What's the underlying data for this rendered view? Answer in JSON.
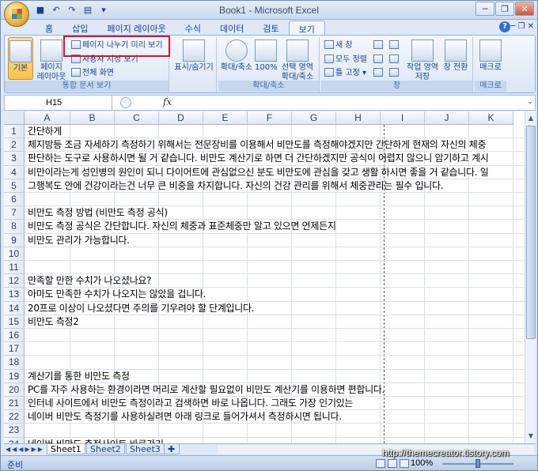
{
  "window": {
    "title": "Book1 - Microsoft Excel"
  },
  "ribbon": {
    "tabs": [
      "홈",
      "삽입",
      "페이지 레이아웃",
      "수식",
      "데이터",
      "검토",
      "보기"
    ],
    "active_tab": "보기",
    "groups": {
      "workbook_views": {
        "label": "통합 문서 보기",
        "normal": "기본",
        "page_layout": "페이지 레이아웃",
        "page_break_preview": "페이지 나누기 미리 보기",
        "custom_views": "사용자 지정 보기",
        "full_screen": "전체 화면"
      },
      "show_hide": {
        "label": "표시/숨기기"
      },
      "zoom": {
        "label": "확대/축소",
        "zoom": "확대/축소",
        "pct100": "100%",
        "zoom_selection": "선택 영역 확대/축소"
      },
      "window": {
        "label": "창",
        "new_window": "새 창",
        "arrange_all": "모두 정렬",
        "freeze": "틀 고정",
        "save_workspace": "작업 영역 저장",
        "switch_windows": "창 전환"
      },
      "macros": {
        "label": "매크로",
        "macros": "매크로"
      }
    }
  },
  "formula_bar": {
    "name_box": "H15",
    "fx": "fx"
  },
  "sheet": {
    "columns": [
      "A",
      "B",
      "C",
      "D",
      "E",
      "F",
      "G",
      "H",
      "I",
      "J",
      "K"
    ],
    "rows": [
      {
        "n": "1",
        "text": "간단하게"
      },
      {
        "n": "2",
        "text": "체지방등 조금 자세하기 측정하기 위해서는 전문장비를 이용해서 비만도를 측정해야겠지만 간단하게 현재의 자신의 체중"
      },
      {
        "n": "3",
        "text": "판단하는 도구로 사용하시면 될 거 같습니다. 비만도 계산기로 하면 더 간단하겠지만 공식이 어렵지 않으니 암기하고 계시"
      },
      {
        "n": "4",
        "text": "비만이라는게 성인병의 원인이 되니 다이어트에 관심없으신 분도 비만도에 관심을 갖고 생활 하시면 좋을 거 같습니다. 일"
      },
      {
        "n": "5",
        "text": "그행복도 안에 건강이라는건 너무 큰 비중을 차지합니다. 자신의 건강 관리를 위해서 체중관리는 필수 입니다."
      },
      {
        "n": "6",
        "text": ""
      },
      {
        "n": "7",
        "text": " 비만도 측정 방법 (비만도 측정 공식)"
      },
      {
        "n": "8",
        "text": "비만도 측정 공식은 간단합니다. 자신의 체중과 표준체중만 알고 있으면 언제든지"
      },
      {
        "n": "9",
        "text": "비만도 관리가 가능합니다."
      },
      {
        "n": "10",
        "text": ""
      },
      {
        "n": "11",
        "text": ""
      },
      {
        "n": "12",
        "text": "만족할 만한 수치가 나오셨나요?"
      },
      {
        "n": "13",
        "text": "아마도 만족한 수치가 나오지는 않았을 겁니다."
      },
      {
        "n": "14",
        "text": "20프로 이상이 나오셨다면 주의를 기우려야 할 단계입니다."
      },
      {
        "n": "15",
        "text": "비만도 측정2"
      },
      {
        "n": "16",
        "text": ""
      },
      {
        "n": "17",
        "text": ""
      },
      {
        "n": "18",
        "text": ""
      },
      {
        "n": "19",
        "text": " 계산기를 통한 비만도 측정"
      },
      {
        "n": "20",
        "text": "PC를 자주 사용하는 환경이라면 머리로 계산할 필요없이 비만도 계산기를 이용하면 편합니다."
      },
      {
        "n": "21",
        "text": "인터네 사이트에서 비만도 측정이라고 검색하면 바로 나옵니다. 그래도 가장 인기있는"
      },
      {
        "n": "22",
        "text": "네이버 비만도 측정기를 사용하실려면 아래 링크로 들어가셔서 측정하시면 됩니다."
      },
      {
        "n": "23",
        "text": ""
      },
      {
        "n": "24",
        "text": "네이버 비만도 측정사이트 바로가기"
      }
    ],
    "tabs": [
      "Sheet1",
      "Sheet2",
      "Sheet3"
    ],
    "active_tab": "Sheet1"
  },
  "status": {
    "ready": "준비",
    "zoom": "100%"
  },
  "watermark": "http://themecreator.tistory.com"
}
